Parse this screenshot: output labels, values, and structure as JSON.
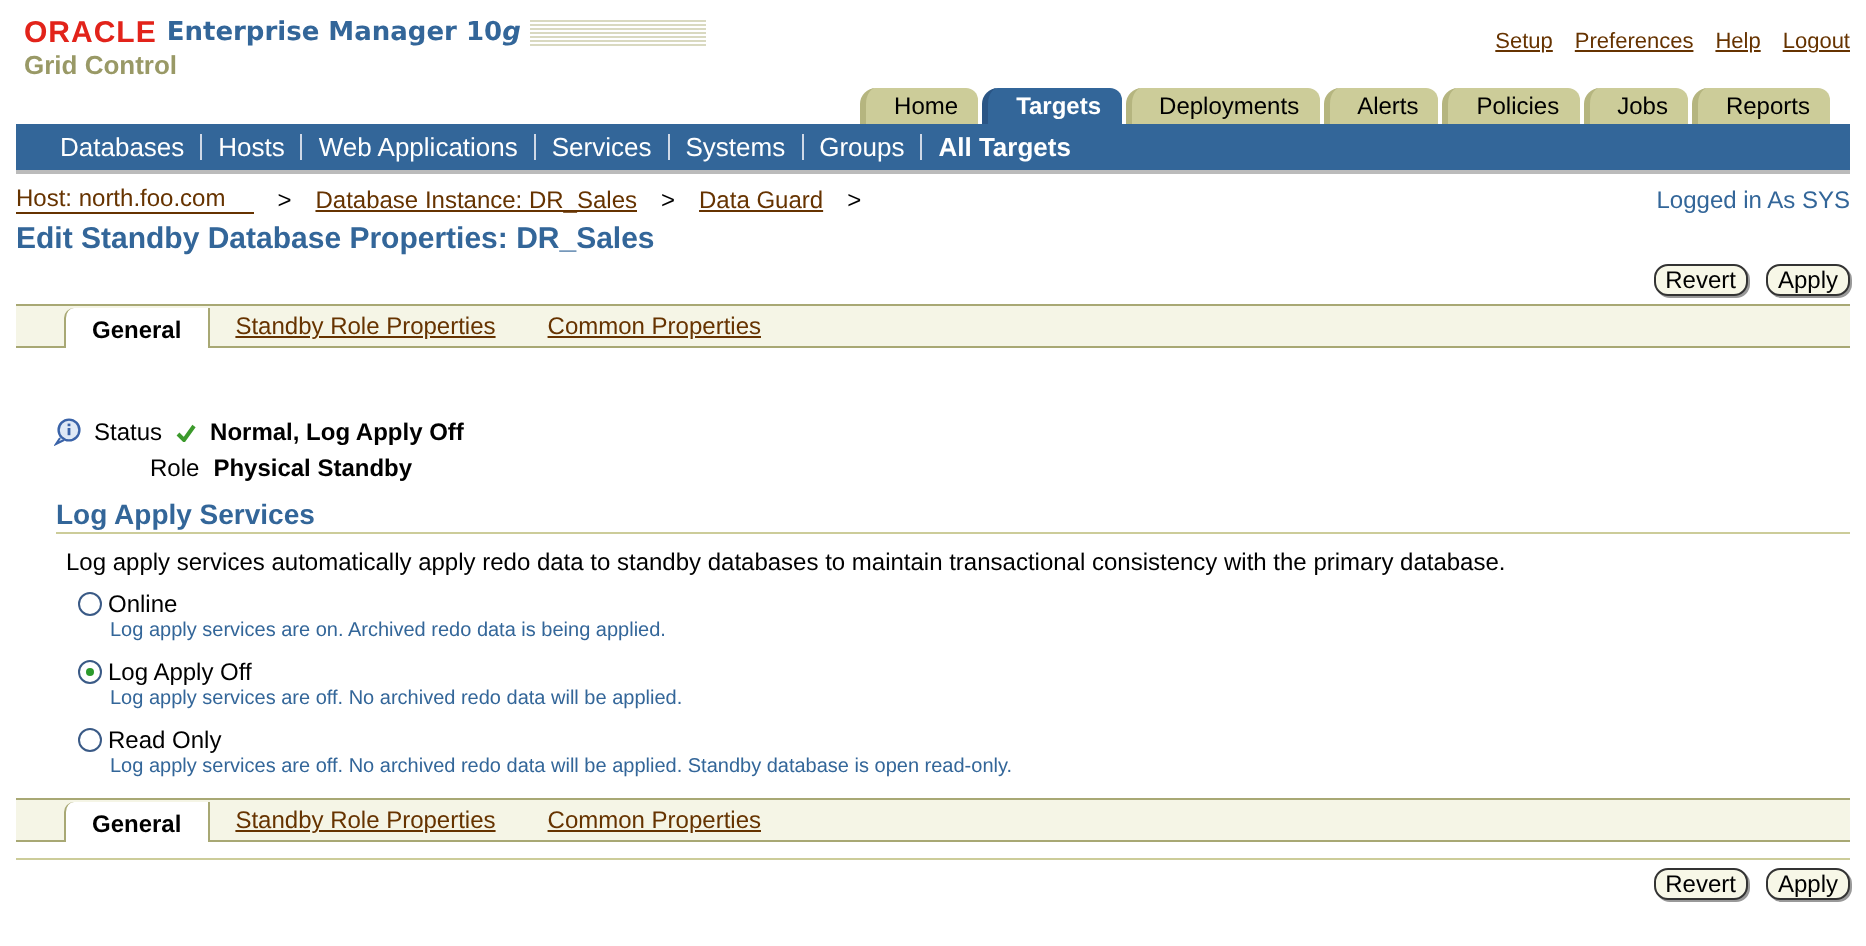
{
  "brand": {
    "logo": "ORACLE",
    "product": "Enterprise Manager 10",
    "product_suffix": "g",
    "subtitle": "Grid Control"
  },
  "global_links": [
    "Setup",
    "Preferences",
    "Help",
    "Logout"
  ],
  "tabs": [
    {
      "label": "Home",
      "selected": false
    },
    {
      "label": "Targets",
      "selected": true
    },
    {
      "label": "Deployments",
      "selected": false
    },
    {
      "label": "Alerts",
      "selected": false
    },
    {
      "label": "Policies",
      "selected": false
    },
    {
      "label": "Jobs",
      "selected": false
    },
    {
      "label": "Reports",
      "selected": false
    }
  ],
  "subnav": [
    {
      "label": "Databases",
      "selected": false
    },
    {
      "label": "Hosts",
      "selected": false
    },
    {
      "label": "Web Applications",
      "selected": false
    },
    {
      "label": "Services",
      "selected": false
    },
    {
      "label": "Systems",
      "selected": false
    },
    {
      "label": "Groups",
      "selected": false
    },
    {
      "label": "All Targets",
      "selected": true
    }
  ],
  "breadcrumbs": [
    "Host:  north.foo.com",
    "Database Instance: DR_Sales",
    "Data Guard"
  ],
  "breadcrumb_separator": ">",
  "logged_in": "Logged in As SYS",
  "page_title": "Edit Standby Database Properties: DR_Sales",
  "top_buttons": [
    "Revert",
    "Apply"
  ],
  "page_tabs_top": [
    {
      "label": "General",
      "selected": true
    },
    {
      "label": "Standby Role Properties",
      "selected": false
    },
    {
      "label": "Common Properties",
      "selected": false
    }
  ],
  "status": {
    "label": "Status",
    "value": "Normal, Log Apply Off",
    "role_label": "Role",
    "role_value": "Physical Standby"
  },
  "section_title": "Log Apply Services",
  "description": "Log apply services automatically apply redo data to standby databases to maintain transactional consistency with the primary database.",
  "options": [
    {
      "label": "Online",
      "selected": false,
      "hint": "Log apply services are on. Archived redo data is being applied."
    },
    {
      "label": "Log Apply Off",
      "selected": true,
      "hint": "Log apply services are off. No archived redo data will be applied."
    },
    {
      "label": "Read Only",
      "selected": false,
      "hint": "Log apply services are off. No archived redo data will be applied. Standby database is open read-only."
    }
  ],
  "page_tabs_bottom": [
    {
      "label": "General",
      "selected": true
    },
    {
      "label": "Standby Role Properties",
      "selected": false
    },
    {
      "label": "Common Properties",
      "selected": false
    }
  ],
  "bottom_buttons": [
    "Revert",
    "Apply"
  ]
}
